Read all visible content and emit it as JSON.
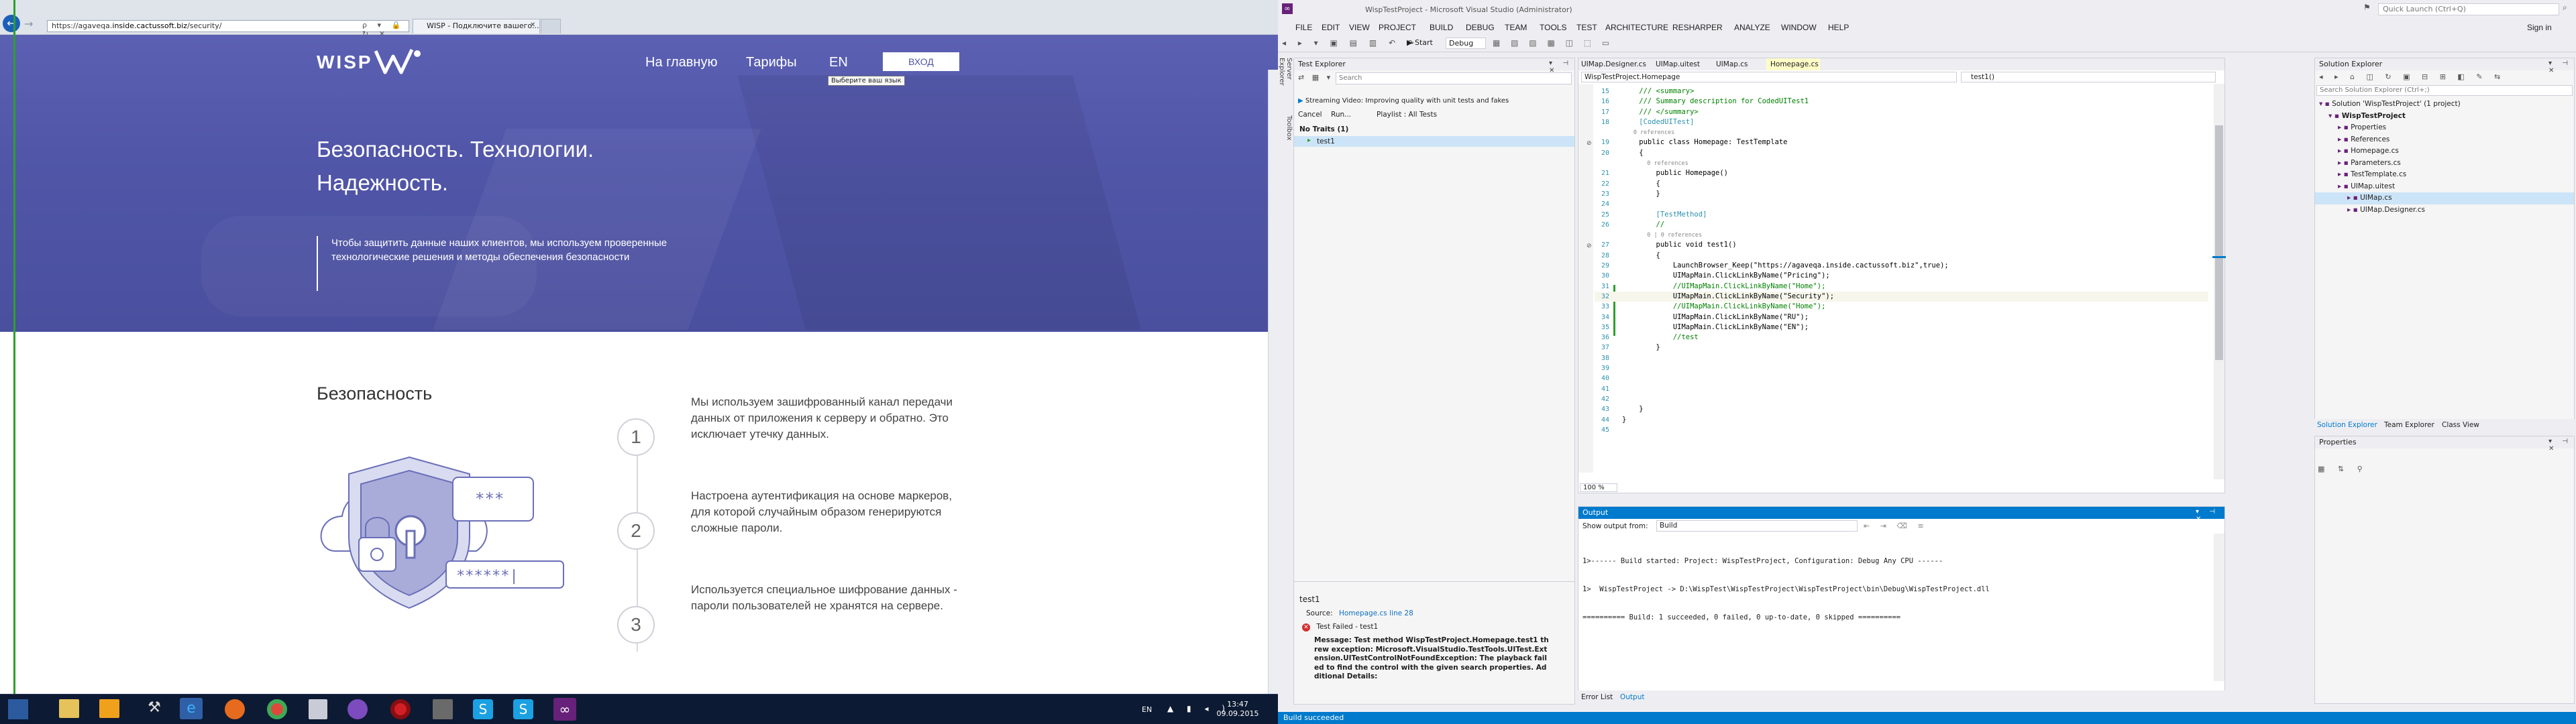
{
  "browser": {
    "url_prefix": "https://agaveqa.",
    "url_domain": "inside.cactussoft.biz",
    "url_suffix": "/security/",
    "tab_title": "WISP - Подключите вашего...",
    "address_icons": "ρ ▾ 🔒 ↻ ✕"
  },
  "site": {
    "logo": "WISP",
    "nav": [
      "На главную",
      "Тарифы",
      "EN"
    ],
    "login": "ВХОД",
    "tooltip": "Выберите ваш язык",
    "hero_title_1": "Безопасность. Технологии.",
    "hero_title_2": "Надежность.",
    "hero_text": "Чтобы защитить данные наших клиентов, мы используем проверенные технологические решения и методы обеспечения безопасности",
    "section_title": "Безопасность",
    "password_stars_top": "***",
    "password_stars_bottom": "******|",
    "steps": [
      {
        "num": "1",
        "text": "Мы используем зашифрованный канал передачи данных от приложения к серверу и обратно. Это исключает утечку данных."
      },
      {
        "num": "2",
        "text": "Настроена аутентификация на основе маркеров, для которой случайным образом генерируются сложные пароли."
      },
      {
        "num": "3",
        "text": "Используется специальное шифрование данных - пароли пользователей не хранятся на сервере."
      }
    ]
  },
  "vs": {
    "title": "WispTestProject - Microsoft Visual Studio (Administrator)",
    "quick_launch": "Quick Launch (Ctrl+Q)",
    "sign_in": "Sign in",
    "menu": [
      "FILE",
      "EDIT",
      "VIEW",
      "PROJECT",
      "BUILD",
      "DEBUG",
      "TEAM",
      "TOOLS",
      "TEST",
      "ARCHITECTURE",
      "RESHARPER",
      "ANALYZE",
      "WINDOW",
      "HELP"
    ],
    "toolbar": {
      "start": "▶ Start",
      "config": "Debug"
    },
    "side_tabs": [
      "Server Explorer",
      "Toolbox"
    ],
    "test_explorer": {
      "title": "Test Explorer",
      "search_placeholder": "Search",
      "banner": "Streaming Video: Improving quality with unit tests and fakes",
      "cancel": "Cancel",
      "run": "Run...",
      "playlist": "Playlist : All Tests",
      "group": "No Traits (1)",
      "test_item": "test1",
      "detail_title": "test1",
      "source_label": "Source:",
      "source_link": "Homepage.cs line 28",
      "failed_label": "Test Failed - test1",
      "message": "Message: Test method WispTestProject.Homepage.test1 threw exception: Microsoft.VisualStudio.TestTools.UITest.Extension.UITestControlNotFoundException: The playback failed to find the control with the given search properties. Additional Details:"
    },
    "editor": {
      "tabs": [
        "UIMap.Designer.cs",
        "UIMap.uitest",
        "UIMap.cs",
        "Homepage.cs"
      ],
      "nav_left": "WispTestProject.Homepage",
      "nav_right": "test1()",
      "zoom": "100 %",
      "lines": [
        {
          "n": "15",
          "t": "    /// <summary>",
          "c": "cm"
        },
        {
          "n": "16",
          "t": "    /// Summary description for CodedUITest1",
          "c": "cm"
        },
        {
          "n": "17",
          "t": "    /// </summary>",
          "c": "cm"
        },
        {
          "n": "18",
          "t": "    [CodedUITest]",
          "c": "ty"
        },
        {
          "n": "",
          "t": "    0 references",
          "c": "gy"
        },
        {
          "n": "19",
          "t": "    public class Homepage: TestTemplate",
          "c": ""
        },
        {
          "n": "20",
          "t": "    {",
          "c": ""
        },
        {
          "n": "",
          "t": "        0 references",
          "c": "gy"
        },
        {
          "n": "21",
          "t": "        public Homepage()",
          "c": ""
        },
        {
          "n": "22",
          "t": "        {",
          "c": ""
        },
        {
          "n": "23",
          "t": "        }",
          "c": ""
        },
        {
          "n": "24",
          "t": "",
          "c": ""
        },
        {
          "n": "25",
          "t": "        [TestMethod]",
          "c": "ty"
        },
        {
          "n": "26",
          "t": "        //",
          "c": "cm"
        },
        {
          "n": "",
          "t": "        0 | 0 references",
          "c": "gy"
        },
        {
          "n": "27",
          "t": "        public void test1()",
          "c": ""
        },
        {
          "n": "28",
          "t": "        {",
          "c": ""
        },
        {
          "n": "29",
          "t": "            LaunchBrowser_Keep(\"https://agaveqa.inside.cactussoft.biz\",true);",
          "c": ""
        },
        {
          "n": "30",
          "t": "            UIMapMain.ClickLinkByName(\"Pricing\");",
          "c": ""
        },
        {
          "n": "31",
          "t": "            //UIMapMain.ClickLinkByName(\"Home\");",
          "c": "cm"
        },
        {
          "n": "32",
          "t": "            UIMapMain.ClickLinkByName(\"Security\");",
          "c": ""
        },
        {
          "n": "33",
          "t": "            //UIMapMain.ClickLinkByName(\"Home\");",
          "c": "cm"
        },
        {
          "n": "34",
          "t": "            UIMapMain.ClickLinkByName(\"RU\");",
          "c": ""
        },
        {
          "n": "35",
          "t": "            UIMapMain.ClickLinkByName(\"EN\");",
          "c": ""
        },
        {
          "n": "36",
          "t": "            //test",
          "c": "cm"
        },
        {
          "n": "37",
          "t": "        }",
          "c": ""
        },
        {
          "n": "38",
          "t": "",
          "c": ""
        },
        {
          "n": "39",
          "t": "",
          "c": ""
        },
        {
          "n": "40",
          "t": "",
          "c": ""
        },
        {
          "n": "41",
          "t": "",
          "c": ""
        },
        {
          "n": "42",
          "t": "",
          "c": ""
        },
        {
          "n": "43",
          "t": "    }",
          "c": ""
        },
        {
          "n": "44",
          "t": "}",
          "c": ""
        },
        {
          "n": "45",
          "t": "",
          "c": ""
        }
      ]
    },
    "solution_explorer": {
      "title": "Solution Explorer",
      "search_placeholder": "Search Solution Explorer (Ctrl+;)",
      "items": [
        {
          "label": "Solution 'WispTestProject' (1 project)",
          "indent": 0
        },
        {
          "label": "WispTestProject",
          "indent": 1
        },
        {
          "label": "Properties",
          "indent": 2
        },
        {
          "label": "References",
          "indent": 2
        },
        {
          "label": "Homepage.cs",
          "indent": 2
        },
        {
          "label": "Parameters.cs",
          "indent": 2
        },
        {
          "label": "TestTemplate.cs",
          "indent": 2
        },
        {
          "label": "UIMap.uitest",
          "indent": 2
        },
        {
          "label": "UIMap.cs",
          "indent": 3
        },
        {
          "label": "UIMap.Designer.cs",
          "indent": 3
        }
      ],
      "tabs": [
        "Solution Explorer",
        "Team Explorer",
        "Class View"
      ]
    },
    "properties": {
      "title": "Properties"
    },
    "output": {
      "title": "Output",
      "show_from_label": "Show output from:",
      "show_from_value": "Build",
      "lines": [
        "1>------ Build started: Project: WispTestProject, Configuration: Debug Any CPU ------",
        "1>  WispTestProject -> D:\\WispTest\\WispTestProject\\WispTestProject\\bin\\Debug\\WispTestProject.dll",
        "========== Build: 1 succeeded, 0 failed, 0 up-to-date, 0 skipped =========="
      ],
      "tabs": [
        "Error List",
        "Output"
      ]
    },
    "status": "Build succeeded"
  },
  "taskbar": {
    "lang": "EN",
    "time": "13:47",
    "date": "09.09.2015"
  },
  "colors": {
    "hero": "#5156a8",
    "vs_accent": "#007acc",
    "taskbar": "#0d1a33"
  }
}
